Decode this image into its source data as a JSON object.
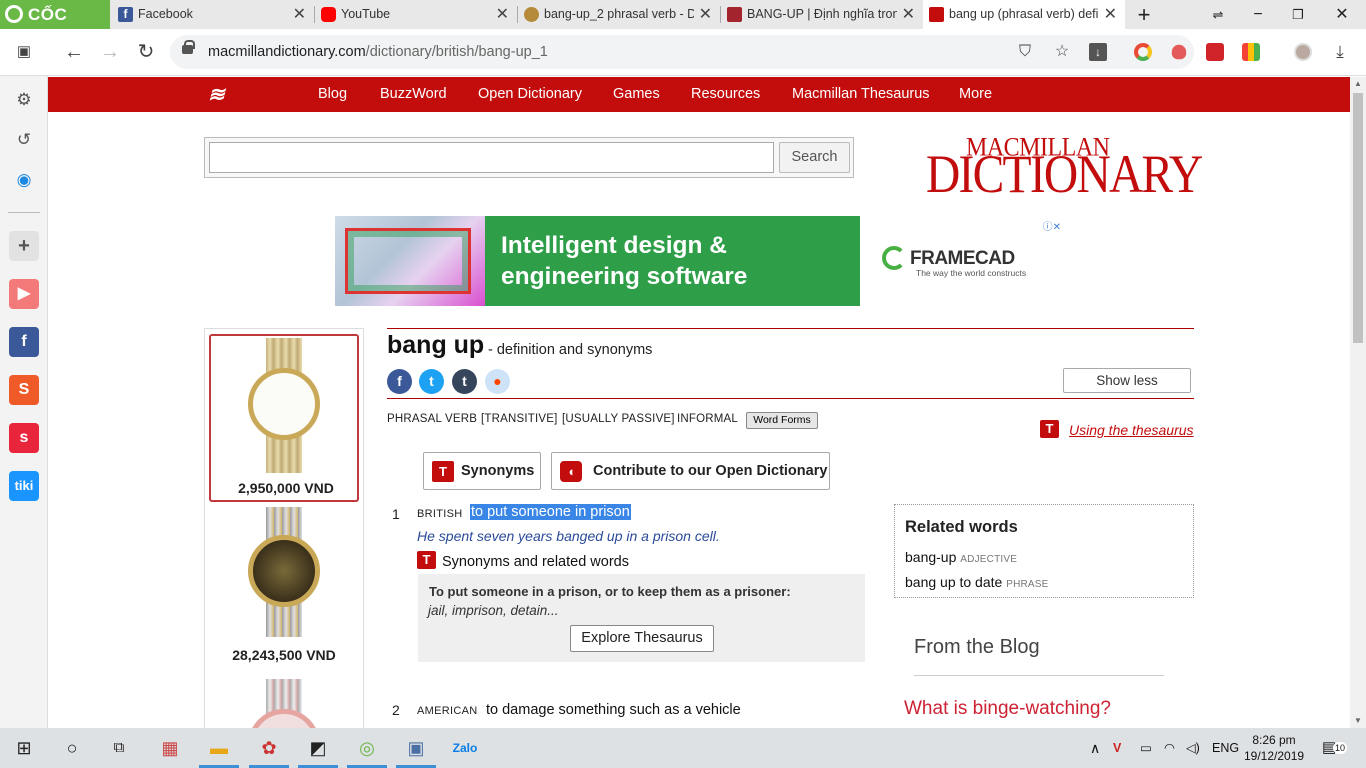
{
  "browser": {
    "brand_label": "CỐC CỐC",
    "tabs": [
      {
        "label": "Facebook",
        "color": "#3b5998"
      },
      {
        "label": "YouTube",
        "color": "#ff0000"
      },
      {
        "label": "bang-up_2 phrasal verb - D",
        "color": "#7a5b2a"
      },
      {
        "label": "BANG-UP | Định nghĩa tron",
        "color": "#a3242c"
      },
      {
        "label": "bang up (phrasal verb) defi",
        "color": "#c30c0c"
      }
    ],
    "close_glyph": "✕",
    "new_tab_glyph": "+",
    "url_domain": "macmillandictionary.com",
    "url_path": "/dictionary/british/bang-up_1"
  },
  "site_nav": {
    "items": [
      "Blog",
      "BuzzWord",
      "Open Dictionary",
      "Games",
      "Resources",
      "Macmillan Thesaurus",
      "More"
    ]
  },
  "search": {
    "value": "",
    "button_label": "Search"
  },
  "logo": {
    "top": "MACMILLAN",
    "bottom": "DICTIONARY"
  },
  "ad": {
    "line1": "Intelligent design &",
    "line2": "engineering software",
    "brand": "FRAMECAD",
    "tagline": "The way the world constructs"
  },
  "products": [
    {
      "price": "2,950,000 VND"
    },
    {
      "price": "28,243,500 VND"
    }
  ],
  "entry": {
    "headword": "bang up",
    "subtitle": "- definition and synonyms",
    "show_less": "Show less",
    "grammar": [
      "PHRASAL VERB",
      "[TRANSITIVE]",
      "[USUALLY PASSIVE]",
      "INFORMAL"
    ],
    "word_forms": "Word Forms",
    "using_thesaurus": "Using the thesaurus",
    "synonyms_button": "Synonyms",
    "contribute_button": "Contribute to our Open Dictionary",
    "senses": [
      {
        "num": "1",
        "variety": "BRITISH",
        "definition": "to put someone in prison",
        "example": "He spent seven years banged up in a prison cell.",
        "syn_label": "Synonyms and related words",
        "thes_heading": "To put someone in a prison, or to keep them as a prisoner:",
        "thes_words": "jail, imprison, detain...",
        "explore": "Explore Thesaurus"
      },
      {
        "num": "2",
        "variety": "AMERICAN",
        "definition": "to damage something such as a vehicle"
      }
    ]
  },
  "related": {
    "heading": "Related words",
    "items": [
      {
        "word": "bang-up",
        "pos": "ADJECTIVE"
      },
      {
        "word": "bang up to date",
        "pos": "PHRASE"
      }
    ]
  },
  "blog": {
    "heading": "From the Blog",
    "title": "What is binge-watching?"
  },
  "taskbar": {
    "language": "ENG",
    "time": "8:26 pm",
    "date": "19/12/2019",
    "notification_count": "10"
  },
  "colors": {
    "brand_red": "#c30c0c",
    "highlight": "#3a86e6"
  }
}
